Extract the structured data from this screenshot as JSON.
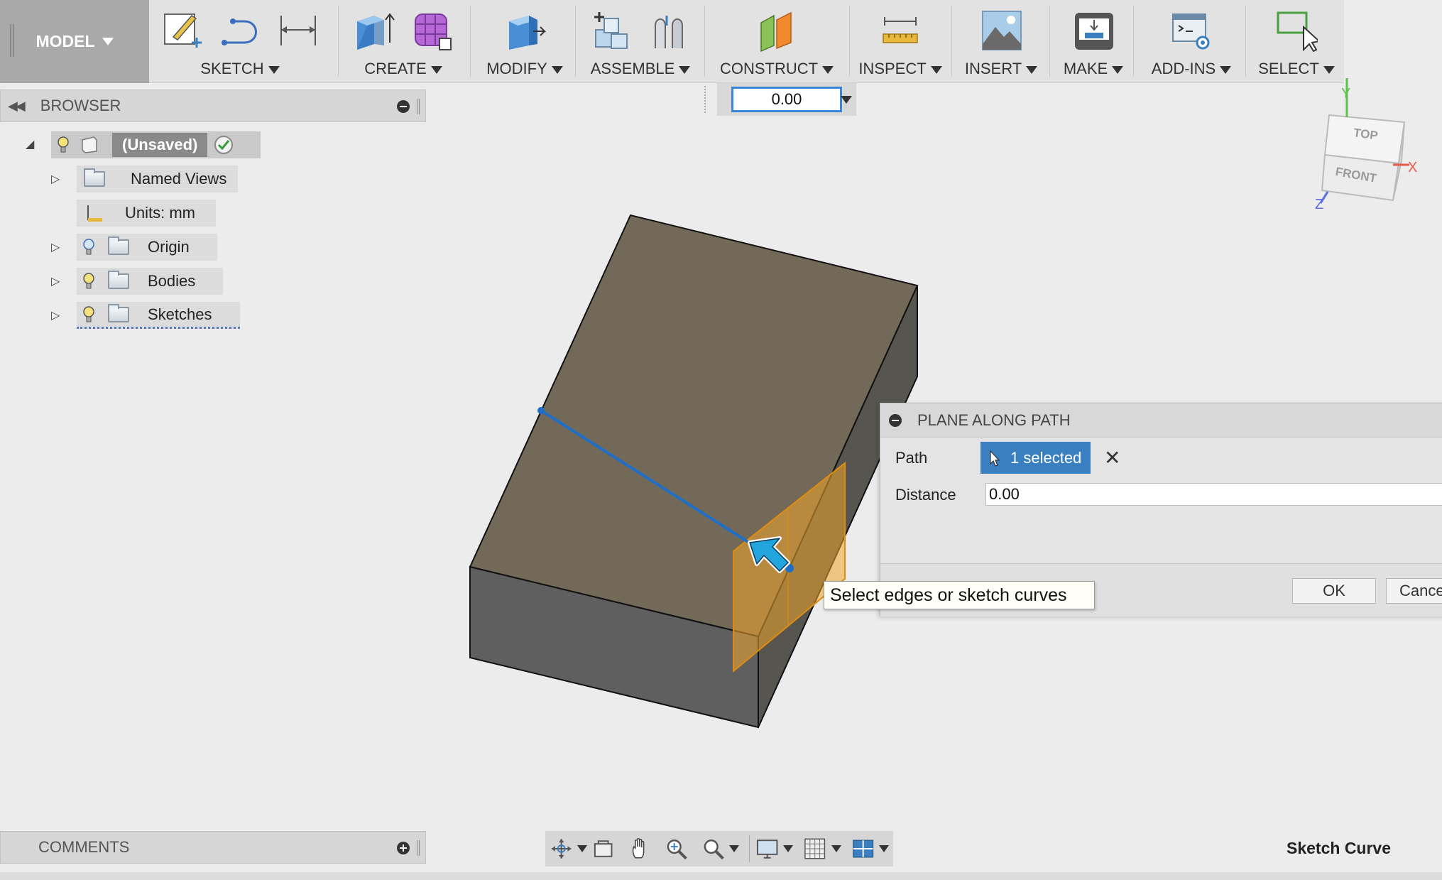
{
  "toolbar": {
    "workspace": "MODEL",
    "groups": [
      {
        "label": "SKETCH"
      },
      {
        "label": "CREATE"
      },
      {
        "label": "MODIFY"
      },
      {
        "label": "ASSEMBLE"
      },
      {
        "label": "CONSTRUCT"
      },
      {
        "label": "INSPECT"
      },
      {
        "label": "INSERT"
      },
      {
        "label": "MAKE"
      },
      {
        "label": "ADD-INS"
      },
      {
        "label": "SELECT"
      }
    ]
  },
  "browser": {
    "title": "BROWSER",
    "root": "(Unsaved)",
    "items": [
      {
        "label": "Named Views"
      },
      {
        "label": "Units: mm"
      },
      {
        "label": "Origin"
      },
      {
        "label": "Bodies"
      },
      {
        "label": "Sketches"
      }
    ]
  },
  "canvas": {
    "value_input": "0.00",
    "viewcube": {
      "top": "TOP",
      "front": "FRONT",
      "axis_x": "X",
      "axis_y": "Y",
      "axis_z": "Z"
    }
  },
  "dialog": {
    "title": "PLANE ALONG PATH",
    "path_label": "Path",
    "path_value": "1 selected",
    "distance_label": "Distance",
    "distance_value": "0.00",
    "ok": "OK",
    "cancel": "Cancel"
  },
  "tooltip": "Select edges or sketch curves",
  "comments": {
    "title": "COMMENTS"
  },
  "status": "Sketch Curve",
  "colors": {
    "accent": "#3a7fc0",
    "body_top": "#736958",
    "body_side": "#5e5d59",
    "plane": "#f0a52c",
    "path_line": "#1f6fc9"
  }
}
